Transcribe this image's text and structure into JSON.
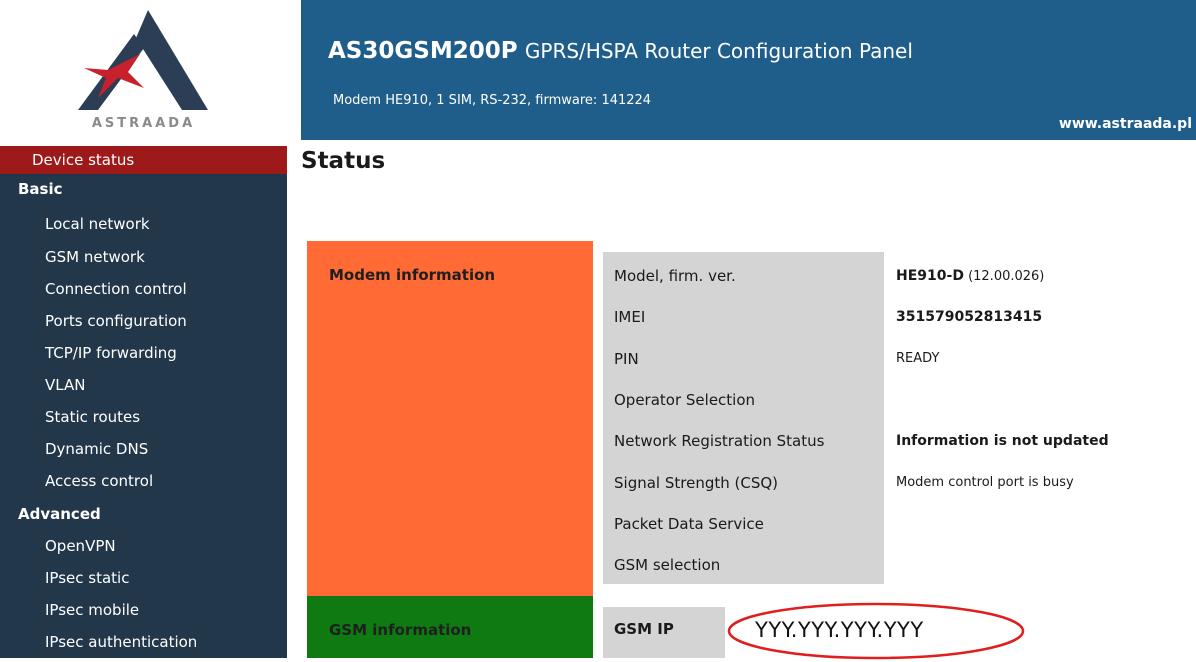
{
  "logo": {
    "text": "ASTRAADA"
  },
  "header": {
    "title_main": "AS30GSM200P",
    "title_rest": "GPRS/HSPA Router Configuration Panel",
    "subtitle": "Modem HE910, 1 SIM, RS-232, firmware: 141224",
    "website": "www.astraada.pl",
    "background_color": "#1f5d8a"
  },
  "sidebar": {
    "active": {
      "label": "Device status"
    },
    "basic_group": "Basic",
    "basic_items": [
      {
        "label": "Local network"
      },
      {
        "label": "GSM network"
      },
      {
        "label": "Connection control"
      },
      {
        "label": "Ports configuration"
      },
      {
        "label": "TCP/IP forwarding"
      },
      {
        "label": "VLAN"
      },
      {
        "label": "Static routes"
      },
      {
        "label": "Dynamic DNS"
      },
      {
        "label": "Access control"
      }
    ],
    "advanced_group": "Advanced",
    "advanced_items": [
      {
        "label": "OpenVPN"
      },
      {
        "label": "IPsec static"
      },
      {
        "label": "IPsec mobile"
      },
      {
        "label": "IPsec authentication"
      }
    ]
  },
  "main": {
    "title": "Status",
    "modem_section": {
      "label": "Modem information",
      "color": "#ff6a35",
      "rows": [
        {
          "label": "Model, firm. ver.",
          "value_bold": "HE910-D",
          "value": " (12.00.026)"
        },
        {
          "label": "IMEI",
          "value_bold": "351579052813415"
        },
        {
          "label": "PIN",
          "value": "READY"
        },
        {
          "label": "Operator Selection"
        },
        {
          "label": "Network Registration Status",
          "value_bold": "Information is not updated"
        },
        {
          "label": "Signal Strength (CSQ)",
          "value": "Modem control port is busy"
        },
        {
          "label": "Packet Data Service"
        },
        {
          "label": "GSM selection"
        }
      ]
    },
    "gsm_section": {
      "label": "GSM information",
      "color": "#0f7a12",
      "ip_label": "GSM IP",
      "ip_value": "YYY.YYY.YYY.YYY"
    }
  }
}
